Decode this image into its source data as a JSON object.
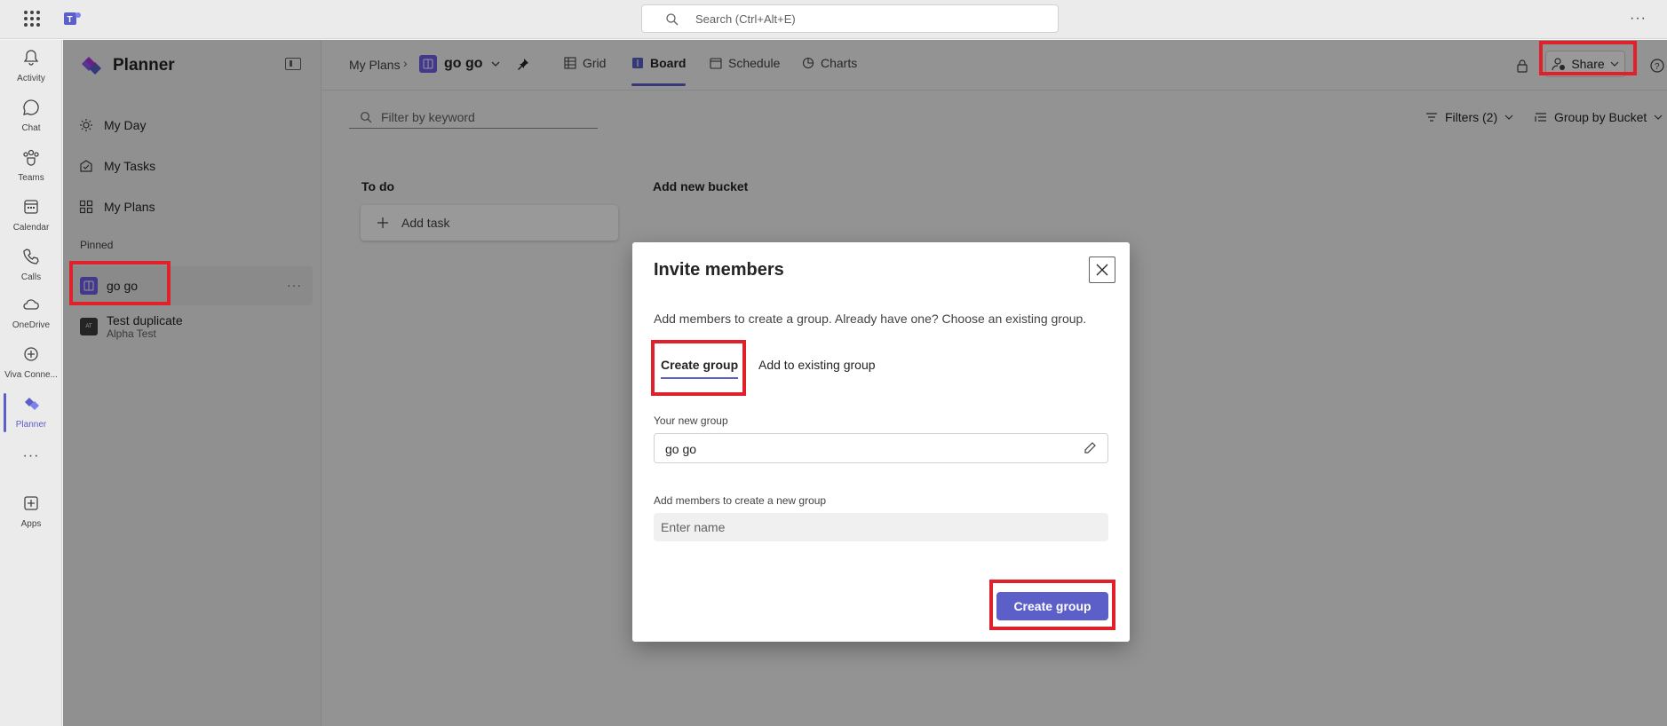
{
  "topbar": {
    "search_placeholder": "Search (Ctrl+Alt+E)",
    "more_label": "···"
  },
  "rail": {
    "items": [
      {
        "label": "Activity",
        "icon": "bell-icon"
      },
      {
        "label": "Chat",
        "icon": "chat-icon"
      },
      {
        "label": "Teams",
        "icon": "teams-icon"
      },
      {
        "label": "Calendar",
        "icon": "calendar-icon"
      },
      {
        "label": "Calls",
        "icon": "phone-icon"
      },
      {
        "label": "OneDrive",
        "icon": "cloud-icon"
      },
      {
        "label": "Viva Conne...",
        "icon": "viva-icon"
      },
      {
        "label": "Planner",
        "icon": "planner-icon",
        "active": true
      },
      {
        "label": "···",
        "icon": "more-icon"
      },
      {
        "label": "Apps",
        "icon": "apps-icon"
      }
    ]
  },
  "sidebar": {
    "app_title": "Planner",
    "nav": [
      {
        "label": "My Day",
        "icon": "sun-icon"
      },
      {
        "label": "My Tasks",
        "icon": "tasks-icon"
      },
      {
        "label": "My Plans",
        "icon": "grid-icon"
      }
    ],
    "pinned_label": "Pinned",
    "pinned": [
      {
        "label": "go go",
        "selected": true,
        "more": "···"
      },
      {
        "label": "Test duplicate",
        "sub": "Alpha Test",
        "badge": "AT"
      }
    ]
  },
  "header": {
    "breadcrumb": "My Plans",
    "breadcrumb_sep": "›",
    "plan_name": "go go",
    "tabs": [
      {
        "label": "Grid",
        "icon": "grid-icon"
      },
      {
        "label": "Board",
        "icon": "board-icon",
        "active": true
      },
      {
        "label": "Schedule",
        "icon": "schedule-icon"
      },
      {
        "label": "Charts",
        "icon": "charts-icon"
      }
    ],
    "share_label": "Share"
  },
  "toolbar": {
    "filter_placeholder": "Filter by keyword",
    "filters_label": "Filters (2)",
    "group_by_label": "Group by Bucket"
  },
  "board": {
    "buckets": [
      {
        "title": "To do",
        "add_task": "Add task"
      }
    ],
    "add_bucket_label": "Add new bucket"
  },
  "dialog": {
    "title": "Invite members",
    "description": "Add members to create a group. Already have one? Choose an existing group.",
    "tabs": [
      {
        "label": "Create group",
        "active": true
      },
      {
        "label": "Add to existing group"
      }
    ],
    "group_field_label": "Your new group",
    "group_field_value": "go go",
    "members_field_label": "Add members to create a new group",
    "members_placeholder": "Enter name",
    "submit_label": "Create group"
  },
  "colors": {
    "accent": "#5b5fc7",
    "highlight": "#e0202a"
  }
}
